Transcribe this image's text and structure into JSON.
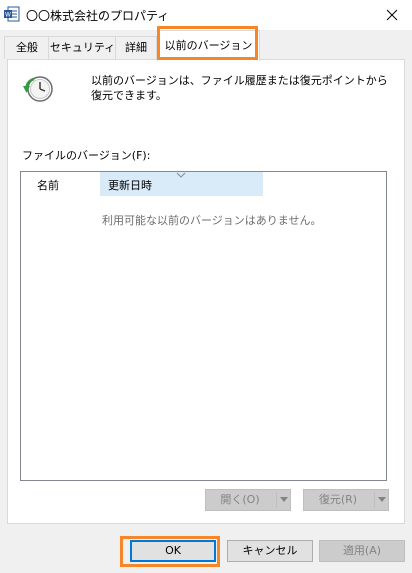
{
  "window": {
    "title": "〇〇株式会社のプロパティ"
  },
  "tabs": [
    {
      "label": "全般"
    },
    {
      "label": "セキュリティ"
    },
    {
      "label": "詳細"
    },
    {
      "label": "以前のバージョン",
      "active": true
    }
  ],
  "previous_versions": {
    "description": "以前のバージョンは、ファイル履歴または復元ポイントから復元できます。",
    "list_label": "ファイルのバージョン(F):",
    "columns": {
      "name": "名前",
      "date_modified": "更新日時"
    },
    "empty_message": "利用可能な以前のバージョンはありません。",
    "open_button": "開く(O)",
    "restore_button": "復元(R)"
  },
  "buttons": {
    "ok": "OK",
    "cancel": "キャンセル",
    "apply": "適用(A)"
  },
  "colors": {
    "highlight": "#f5872a",
    "selected_column": "#d9ebf9",
    "ok_border": "#0078d7"
  },
  "icons": {
    "app": "word-document-icon",
    "close": "close-icon",
    "versions": "clock-restore-icon"
  }
}
